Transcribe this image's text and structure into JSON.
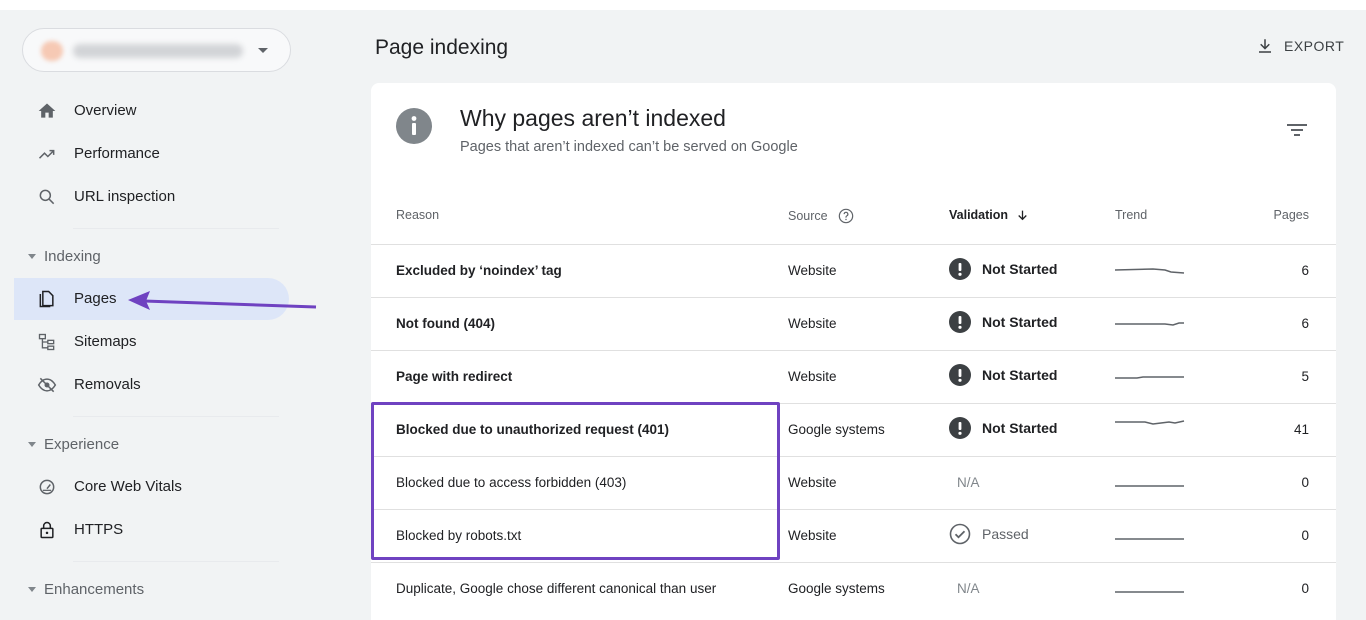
{
  "sidebar": {
    "items": [
      {
        "label": "Overview",
        "icon": "home-icon"
      },
      {
        "label": "Performance",
        "icon": "trending-up-icon"
      },
      {
        "label": "URL inspection",
        "icon": "search-icon"
      }
    ],
    "sections": [
      {
        "label": "Indexing",
        "items": [
          {
            "label": "Pages",
            "icon": "pages-icon",
            "active": true
          },
          {
            "label": "Sitemaps",
            "icon": "sitemap-icon"
          },
          {
            "label": "Removals",
            "icon": "eye-off-icon"
          }
        ]
      },
      {
        "label": "Experience",
        "items": [
          {
            "label": "Core Web Vitals",
            "icon": "gauge-icon"
          },
          {
            "label": "HTTPS",
            "icon": "lock-icon"
          }
        ]
      },
      {
        "label": "Enhancements",
        "items": []
      }
    ]
  },
  "header": {
    "title": "Page indexing",
    "export_label": "EXPORT"
  },
  "card": {
    "title": "Why pages aren’t indexed",
    "subtitle": "Pages that aren’t indexed can’t be served on Google",
    "columns": {
      "reason": "Reason",
      "source": "Source",
      "validation": "Validation",
      "trend": "Trend",
      "pages": "Pages"
    },
    "rows": [
      {
        "reason": "Excluded by ‘noindex’ tag",
        "source": "Website",
        "validation": "Not Started",
        "pages": "6"
      },
      {
        "reason": "Not found (404)",
        "source": "Website",
        "validation": "Not Started",
        "pages": "6"
      },
      {
        "reason": "Page with redirect",
        "source": "Website",
        "validation": "Not Started",
        "pages": "5"
      },
      {
        "reason": "Blocked due to unauthorized request (401)",
        "source": "Google systems",
        "validation": "Not Started",
        "pages": "41"
      },
      {
        "reason": "Blocked due to access forbidden (403)",
        "source": "Website",
        "validation": "N/A",
        "pages": "0"
      },
      {
        "reason": "Blocked by robots.txt",
        "source": "Website",
        "validation": "Passed",
        "pages": "0"
      },
      {
        "reason": "Duplicate, Google chose different canonical than user",
        "source": "Google systems",
        "validation": "N/A",
        "pages": "0"
      }
    ]
  },
  "colors": {
    "accent_active": "#dde6f8",
    "annotation": "#6f42c1",
    "status_icon": "#3c4043"
  }
}
